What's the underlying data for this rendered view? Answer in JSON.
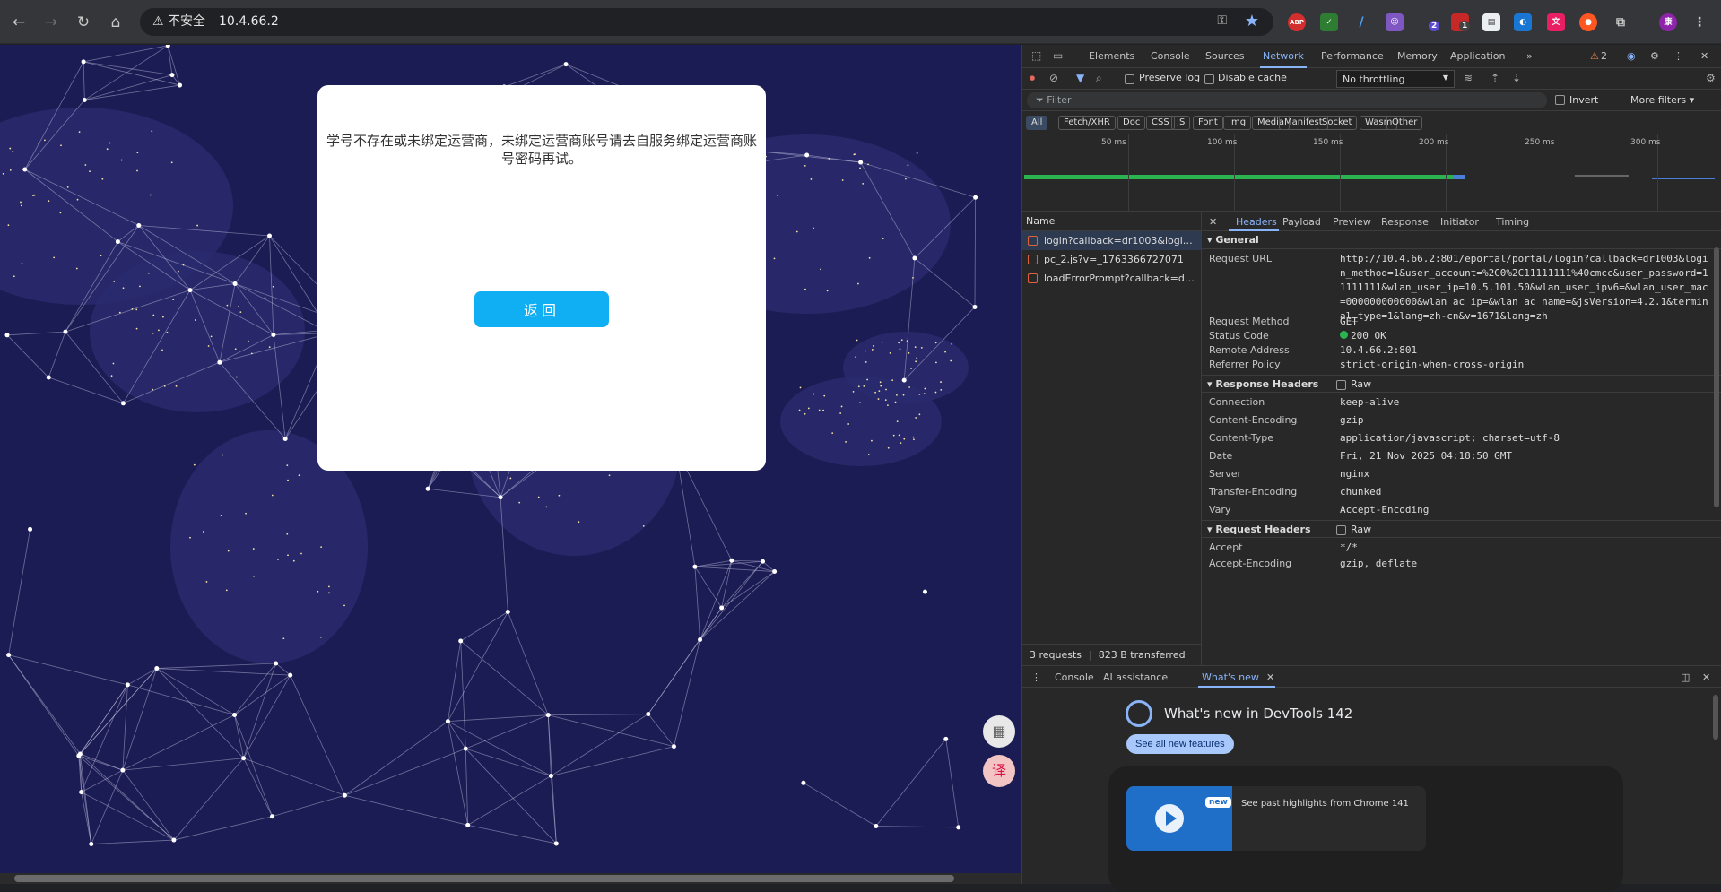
{
  "browser": {
    "security_label": "⚠ 不安全",
    "url": "10.4.66.2",
    "extension_badges": {
      "notif1": "2",
      "notif2": "1"
    }
  },
  "page": {
    "modal_message": "学号不存在或未绑定运营商，未绑定运营商账号请去自服务绑定运营商账号密码再试。",
    "back_button": "返回"
  },
  "devtools": {
    "tabs": [
      "Elements",
      "Console",
      "Sources",
      "Network",
      "Performance",
      "Memory",
      "Application"
    ],
    "issues_count": "2",
    "toolbar": {
      "preserve_log": "Preserve log",
      "disable_cache": "Disable cache",
      "throttling": "No throttling"
    },
    "filter": {
      "placeholder": "Filter",
      "invert": "Invert",
      "more_filters": "More filters ▾"
    },
    "type_filters": [
      "All",
      "Fetch/XHR",
      "Doc",
      "CSS",
      "JS",
      "Font",
      "Img",
      "Media",
      "Manifest",
      "Socket",
      "Wasm",
      "Other"
    ],
    "timeline_ticks": [
      "50 ms",
      "100 ms",
      "150 ms",
      "200 ms",
      "250 ms",
      "300 ms"
    ],
    "name_header": "Name",
    "requests": [
      "login?callback=dr1003&logi…",
      "pc_2.js?v=_1763366727071",
      "loadErrorPrompt?callback=d…"
    ],
    "summary": {
      "requests": "3 requests",
      "transferred": "823 B transferred"
    },
    "detail_tabs": [
      "Headers",
      "Payload",
      "Preview",
      "Response",
      "Initiator",
      "Timing"
    ],
    "general_title": "General",
    "general": [
      {
        "k": "Request URL",
        "v": "http://10.4.66.2:801/eportal/portal/login?callback=dr1003&login_method=1&user_account=%2C0%2C11111111%40cmcc&user_password=11111111&wlan_user_ip=10.5.101.50&wlan_user_ipv6=&wlan_user_mac=000000000000&wlan_ac_ip=&wlan_ac_name=&jsVersion=4.2.1&terminal_type=1&lang=zh-cn&v=1671&lang=zh"
      },
      {
        "k": "Request Method",
        "v": "GET"
      },
      {
        "k": "Status Code",
        "v": "200 OK"
      },
      {
        "k": "Remote Address",
        "v": "10.4.66.2:801"
      },
      {
        "k": "Referrer Policy",
        "v": "strict-origin-when-cross-origin"
      }
    ],
    "response_headers_title": "Response Headers",
    "raw_label": "Raw",
    "response_headers": [
      {
        "k": "Connection",
        "v": "keep-alive"
      },
      {
        "k": "Content-Encoding",
        "v": "gzip"
      },
      {
        "k": "Content-Type",
        "v": "application/javascript; charset=utf-8"
      },
      {
        "k": "Date",
        "v": "Fri, 21 Nov 2025 04:18:50 GMT"
      },
      {
        "k": "Server",
        "v": "nginx"
      },
      {
        "k": "Transfer-Encoding",
        "v": "chunked"
      },
      {
        "k": "Vary",
        "v": "Accept-Encoding"
      }
    ],
    "request_headers_title": "Request Headers",
    "request_headers": [
      {
        "k": "Accept",
        "v": "*/*"
      },
      {
        "k": "Accept-Encoding",
        "v": "gzip, deflate"
      }
    ],
    "drawer": {
      "tabs": [
        "Console",
        "AI assistance",
        "What's new"
      ],
      "whats_new_title": "What's new in DevTools 142",
      "see_all": "See all new features",
      "new_badge": "new",
      "highlight": "See past highlights from Chrome 141"
    }
  },
  "colors": {
    "accent": "#8ab4f8",
    "button": "#10aef2",
    "status_ok": "#2bb34f",
    "page_bg": "#1c1c55"
  }
}
